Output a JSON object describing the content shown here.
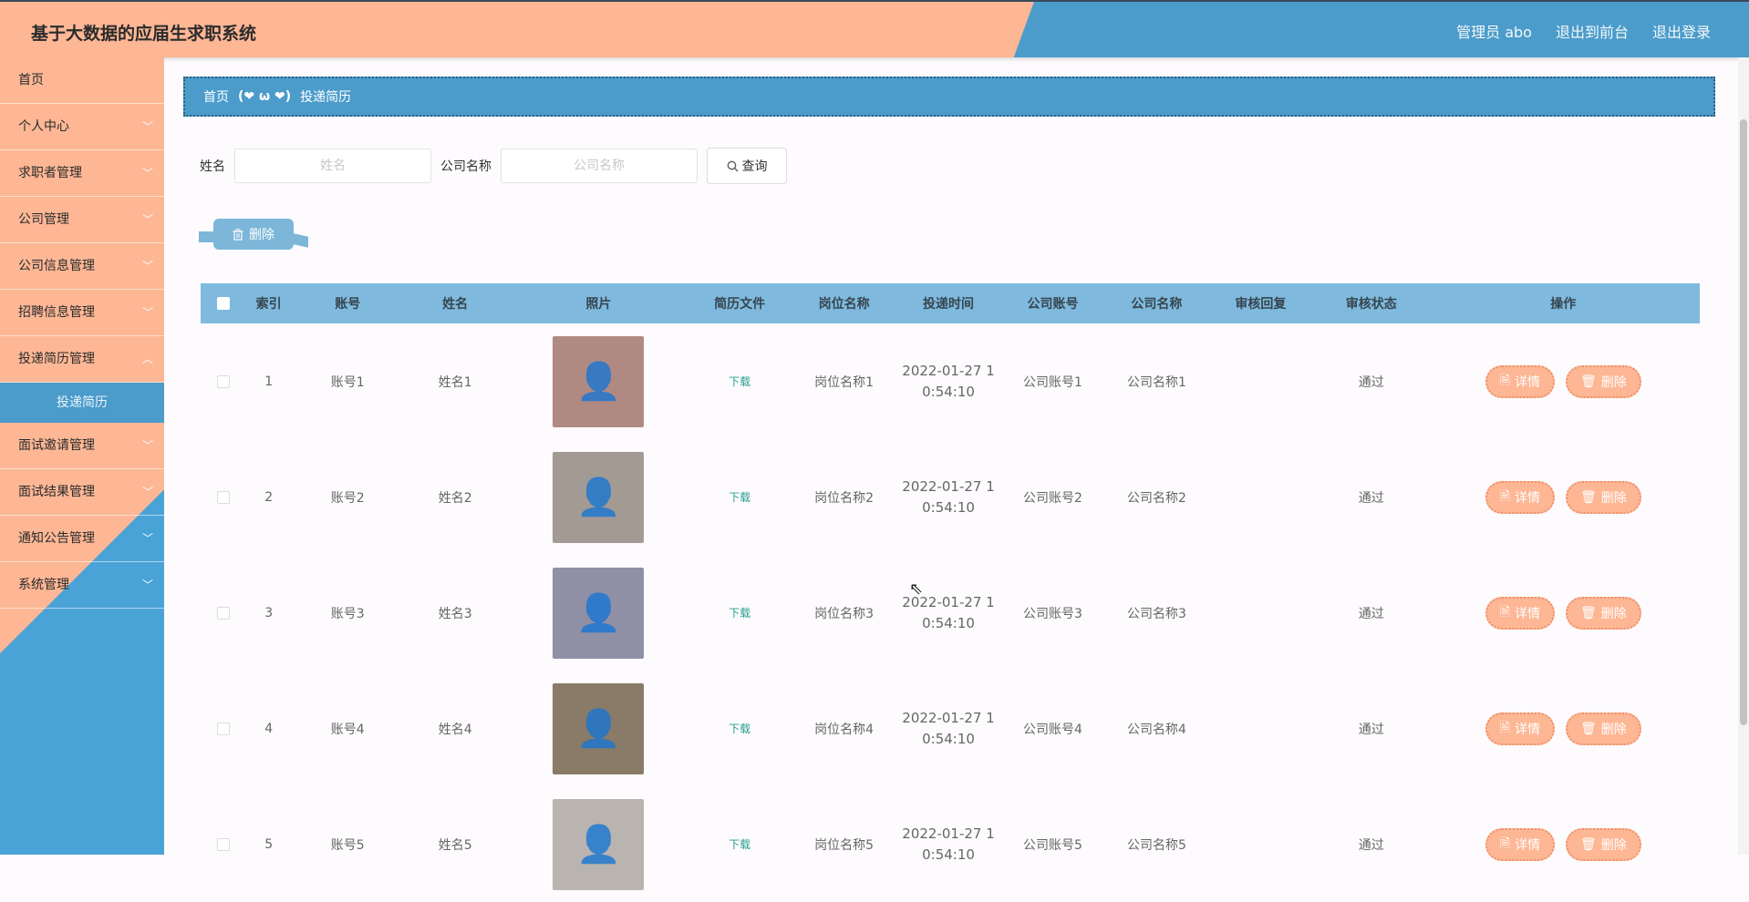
{
  "header": {
    "title": "基于大数据的应届生求职系统",
    "user": "管理员 abo",
    "to_front": "退出到前台",
    "logout": "退出登录"
  },
  "sidebar": {
    "items": [
      {
        "label": "首页"
      },
      {
        "label": "个人中心"
      },
      {
        "label": "求职者管理"
      },
      {
        "label": "公司管理"
      },
      {
        "label": "公司信息管理"
      },
      {
        "label": "招聘信息管理"
      },
      {
        "label": "投递简历管理"
      },
      {
        "label": "面试邀请管理"
      },
      {
        "label": "面试结果管理"
      },
      {
        "label": "通知公告管理"
      },
      {
        "label": "系统管理"
      }
    ],
    "active_sub": "投递简历"
  },
  "breadcrumb": {
    "home": "首页",
    "separator": "(❤ ω ❤)",
    "current": "投递简历"
  },
  "search": {
    "name_label": "姓名",
    "name_placeholder": "姓名",
    "company_label": "公司名称",
    "company_placeholder": "公司名称",
    "query_button": "查询"
  },
  "toolbar": {
    "delete_label": "删除"
  },
  "table": {
    "headers": [
      "索引",
      "账号",
      "姓名",
      "照片",
      "简历文件",
      "岗位名称",
      "投递时间",
      "公司账号",
      "公司名称",
      "审核回复",
      "审核状态",
      "操作"
    ],
    "rows": [
      {
        "index": "1",
        "account": "账号1",
        "name": "姓名1",
        "file": "下载",
        "position": "岗位名称1",
        "time_line1": "2022-01-27 1",
        "time_line2": "0:54:10",
        "company_account": "公司账号1",
        "company_name": "公司名称1",
        "reply": "",
        "status": "通过",
        "photo_color": "#b08a82"
      },
      {
        "index": "2",
        "account": "账号2",
        "name": "姓名2",
        "file": "下载",
        "position": "岗位名称2",
        "time_line1": "2022-01-27 1",
        "time_line2": "0:54:10",
        "company_account": "公司账号2",
        "company_name": "公司名称2",
        "reply": "",
        "status": "通过",
        "photo_color": "#a39a94"
      },
      {
        "index": "3",
        "account": "账号3",
        "name": "姓名3",
        "file": "下载",
        "position": "岗位名称3",
        "time_line1": "2022-01-27 1",
        "time_line2": "0:54:10",
        "company_account": "公司账号3",
        "company_name": "公司名称3",
        "reply": "",
        "status": "通过",
        "photo_color": "#8f8fa6"
      },
      {
        "index": "4",
        "account": "账号4",
        "name": "姓名4",
        "file": "下载",
        "position": "岗位名称4",
        "time_line1": "2022-01-27 1",
        "time_line2": "0:54:10",
        "company_account": "公司账号4",
        "company_name": "公司名称4",
        "reply": "",
        "status": "通过",
        "photo_color": "#8a7a68"
      },
      {
        "index": "5",
        "account": "账号5",
        "name": "姓名5",
        "file": "下载",
        "position": "岗位名称5",
        "time_line1": "2022-01-27 1",
        "time_line2": "0:54:10",
        "company_account": "公司账号5",
        "company_name": "公司名称5",
        "reply": "",
        "status": "通过",
        "photo_color": "#b9b4b0"
      }
    ],
    "detail_label": "详情",
    "delete_label": "删除"
  },
  "colors": {
    "accent_peach": "#fdb795",
    "accent_blue": "#4c9ccb",
    "table_header": "#7fbade"
  }
}
